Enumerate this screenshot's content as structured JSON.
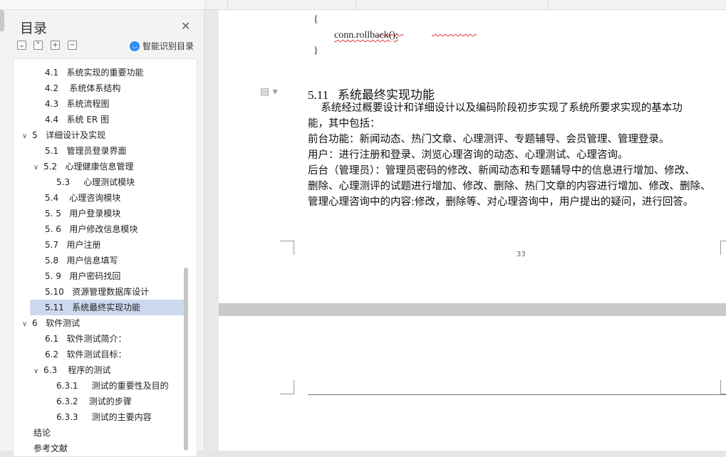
{
  "outline": {
    "title": "目录",
    "close_icon": "close-icon",
    "toolbar_buttons": [
      "⌄",
      "⌃",
      "+",
      "−"
    ],
    "smart_label": "智能识别目录",
    "items": [
      {
        "label": "4.1   系统实现的重要功能",
        "indent": 1,
        "arrow": ""
      },
      {
        "label": "4.2    系统体系结构",
        "indent": 1,
        "arrow": ""
      },
      {
        "label": "4.3   系统流程图",
        "indent": 1,
        "arrow": ""
      },
      {
        "label": "4.4   系统 ER 图",
        "indent": 1,
        "arrow": ""
      },
      {
        "label": "5   详细设计及实现",
        "indent": 0,
        "arrow": "∨"
      },
      {
        "label": "5.1   管理员登录界面",
        "indent": 1,
        "arrow": ""
      },
      {
        "label": "5.2   心理健康信息管理",
        "indent": 1,
        "arrow": "∨"
      },
      {
        "label": "5.3     心理测试模块",
        "indent": 2,
        "arrow": ""
      },
      {
        "label": "5.4    心理咨询模块",
        "indent": 1,
        "arrow": ""
      },
      {
        "label": "5. 5   用户登录模块",
        "indent": 1,
        "arrow": ""
      },
      {
        "label": "5. 6   用户修改信息模块",
        "indent": 1,
        "arrow": ""
      },
      {
        "label": "5.7   用户注册",
        "indent": 1,
        "arrow": ""
      },
      {
        "label": "5.8   用户信息填写",
        "indent": 1,
        "arrow": ""
      },
      {
        "label": "5. 9   用户密码找回",
        "indent": 1,
        "arrow": ""
      },
      {
        "label": "5.10   资源管理数据库设计",
        "indent": 1,
        "arrow": ""
      },
      {
        "label": "5.11   系统最终实现功能",
        "indent": 1,
        "arrow": "",
        "selected": true
      },
      {
        "label": "6   软件测试",
        "indent": 0,
        "arrow": "∨"
      },
      {
        "label": "6.1   软件测试简介：",
        "indent": 1,
        "arrow": ""
      },
      {
        "label": "6.2   软件测试目标：",
        "indent": 1,
        "arrow": ""
      },
      {
        "label": "6.3    程序的测试",
        "indent": 1,
        "arrow": "∨"
      },
      {
        "label": "6.3.1     测试的重要性及目的",
        "indent": 2,
        "arrow": ""
      },
      {
        "label": "6.3.2    测试的步骤",
        "indent": 2,
        "arrow": ""
      },
      {
        "label": "6.3.3     测试的主要内容",
        "indent": 2,
        "arrow": ""
      },
      {
        "label": "结论",
        "indent": -1,
        "arrow": ""
      },
      {
        "label": "参考文献",
        "indent": -1,
        "arrow": ""
      }
    ]
  },
  "document": {
    "code_lines": [
      "{",
      "conn.rollback();",
      "}"
    ],
    "heading": "5.11   系统最终实现功能",
    "paragraphs": [
      "    系统经过概要设计和详细设计以及编码阶段初步实现了系统所要求实现的基本功",
      "能，其中包括：",
      "前台功能：新闻动态、热门文章、心理测评、专题辅导、会员管理、管理登录。",
      "用户：进行注册和登录、浏览心理咨询的动态、心理测试、心理咨询。",
      "后台（管理员）：管理员密码的修改、新闻动态和专题辅导中的信息进行增加、修改、",
      "删除、心理测评的试题进行增加、修改、删除、热门文章的内容进行增加、修改、删除、",
      "管理心理咨询中的内容:修改，删除等、对心理咨询中，用户提出的疑问，进行回答。"
    ],
    "page_number": "33"
  }
}
